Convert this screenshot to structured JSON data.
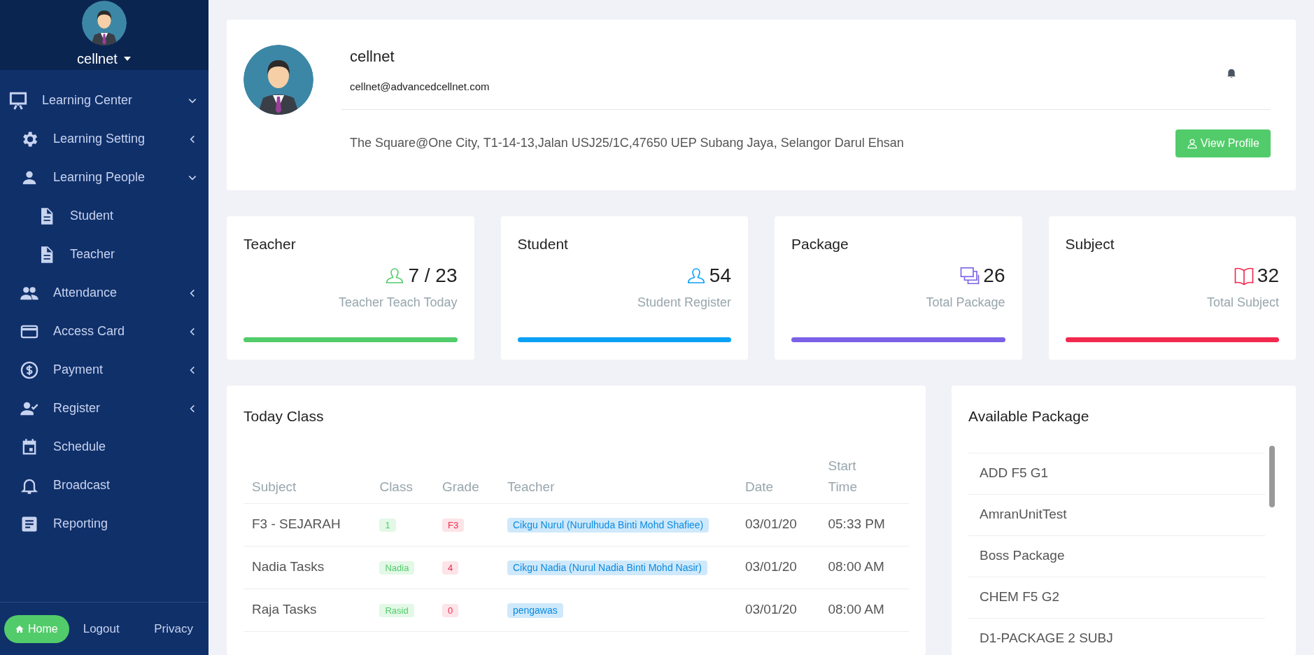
{
  "user_menu": {
    "name": "cellnet"
  },
  "sidebar": {
    "items": [
      {
        "label": "Learning Center",
        "expanded": true,
        "children": [
          {
            "label": "Learning Setting",
            "expanded": false
          },
          {
            "label": "Learning People",
            "expanded": true,
            "children": [
              {
                "label": "Student"
              },
              {
                "label": "Teacher"
              }
            ]
          },
          {
            "label": "Attendance",
            "expanded": false
          },
          {
            "label": "Access Card",
            "expanded": false
          },
          {
            "label": "Payment",
            "expanded": false
          },
          {
            "label": "Register",
            "expanded": false
          },
          {
            "label": "Schedule"
          },
          {
            "label": "Broadcast"
          },
          {
            "label": "Reporting"
          }
        ]
      }
    ],
    "footer": {
      "home": "Home",
      "logout": "Logout",
      "privacy": "Privacy"
    }
  },
  "profile": {
    "name": "cellnet",
    "email": "cellnet@advancedcellnet.com",
    "address": "The Square@One City, T1-14-13,Jalan USJ25/1C,47650 UEP Subang Jaya, Selangor Darul Ehsan",
    "button": "View Profile"
  },
  "stats": [
    {
      "title": "Teacher",
      "value": "7 / 23",
      "caption": "Teacher Teach Today",
      "color": "#52cc6a"
    },
    {
      "title": "Student",
      "value": "54",
      "caption": "Student Register",
      "color": "#0aa1f5"
    },
    {
      "title": "Package",
      "value": "26",
      "caption": "Total Package",
      "color": "#7b61e8"
    },
    {
      "title": "Subject",
      "value": "32",
      "caption": "Total Subject",
      "color": "#f2294e"
    }
  ],
  "today_class": {
    "title": "Today Class",
    "columns": [
      "Subject",
      "Class",
      "Grade",
      "Teacher",
      "Date",
      "Start Time"
    ],
    "rows": [
      {
        "subject": "F3 - SEJARAH",
        "class": "1",
        "grade": "F3",
        "teacher": "Cikgu Nurul (Nurulhuda Binti Mohd Shafiee)",
        "date": "03/01/20",
        "time": "05:33 PM"
      },
      {
        "subject": "Nadia Tasks",
        "class": "Nadia",
        "grade": "4",
        "teacher": "Cikgu Nadia (Nurul Nadia Binti Mohd Nasir)",
        "date": "03/01/20",
        "time": "08:00 AM"
      },
      {
        "subject": "Raja Tasks",
        "class": "Rasid",
        "grade": "0",
        "teacher": "pengawas",
        "date": "03/01/20",
        "time": "08:00 AM"
      }
    ]
  },
  "available_package": {
    "title": "Available Package",
    "items": [
      "ADD F5 G1",
      "AmranUnitTest",
      "Boss Package",
      "CHEM F5 G2",
      "D1-PACKAGE 2 SUBJ"
    ]
  }
}
